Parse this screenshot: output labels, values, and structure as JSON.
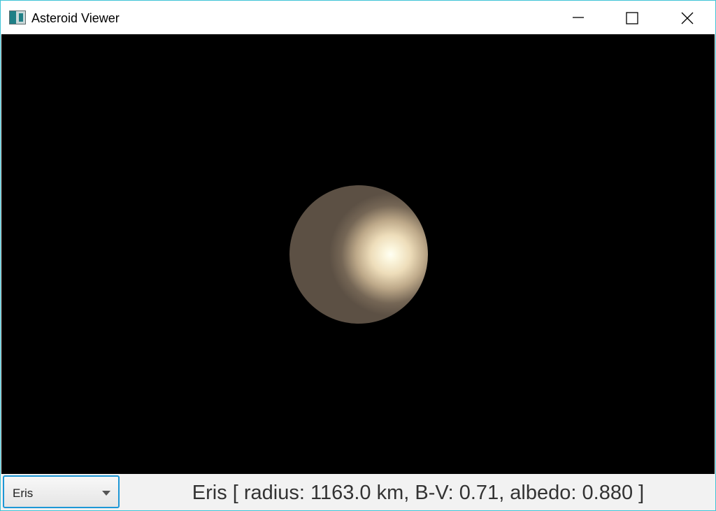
{
  "window": {
    "title": "Asteroid Viewer",
    "icons": {
      "app": "window-app-icon",
      "minimize": "minimize-icon",
      "maximize": "maximize-icon",
      "close": "close-icon"
    }
  },
  "viewport": {
    "background_color": "#000000",
    "sphere_color": "#5c5044",
    "highlight_color": "#fffff4"
  },
  "controls": {
    "asteroid_select": {
      "value": "Eris",
      "icon": "dropdown-arrow-icon"
    }
  },
  "status": {
    "label": "Eris [ radius: 1163.0 km, B-V: 0.71, albedo: 0.880 ]"
  },
  "accent_color": "#1d97d6"
}
